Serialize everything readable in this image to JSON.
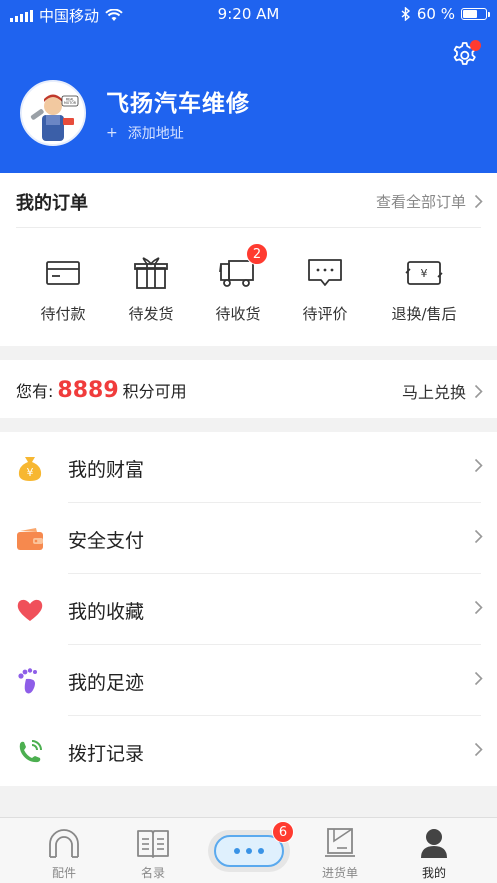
{
  "status_bar": {
    "carrier": "中国移动",
    "time": "9:20 AM",
    "battery": "60 %"
  },
  "profile": {
    "shop_name": "飞扬汽车维修",
    "add_address_icon": "+",
    "add_address_label": "添加地址",
    "avatar_badge_text": "REAL\nMOTOR"
  },
  "orders": {
    "title": "我的订单",
    "view_all": "查看全部订单",
    "items": [
      {
        "label": "待付款",
        "icon": "card-icon"
      },
      {
        "label": "待发货",
        "icon": "gift-icon"
      },
      {
        "label": "待收货",
        "icon": "truck-icon",
        "badge": "2"
      },
      {
        "label": "待评价",
        "icon": "comment-icon"
      },
      {
        "label": "退换/售后",
        "icon": "refund-icon"
      }
    ]
  },
  "points": {
    "prefix": "您有:",
    "value": "8889",
    "suffix": "积分可用",
    "redeem": "马上兑换"
  },
  "menu": [
    {
      "label": "我的财富",
      "icon": "money-bag-icon",
      "color": "#f7b731"
    },
    {
      "label": "安全支付",
      "icon": "wallet-icon",
      "color": "#f6894e"
    },
    {
      "label": "我的收藏",
      "icon": "heart-icon",
      "color": "#f0505a"
    },
    {
      "label": "我的足迹",
      "icon": "footprint-icon",
      "color": "#8e5ee8"
    },
    {
      "label": "拨打记录",
      "icon": "phone-icon",
      "color": "#4caf50"
    }
  ],
  "tabbar": {
    "items": [
      {
        "label": "配件",
        "icon": "parts-icon"
      },
      {
        "label": "名录",
        "icon": "directory-icon"
      },
      {
        "label": "",
        "icon": "chat-icon",
        "badge": "6"
      },
      {
        "label": "进货单",
        "icon": "purchase-icon"
      },
      {
        "label": "我的",
        "icon": "user-icon"
      }
    ]
  },
  "colors": {
    "brand": "#1f63ef",
    "accent_red": "#f03c3c"
  }
}
